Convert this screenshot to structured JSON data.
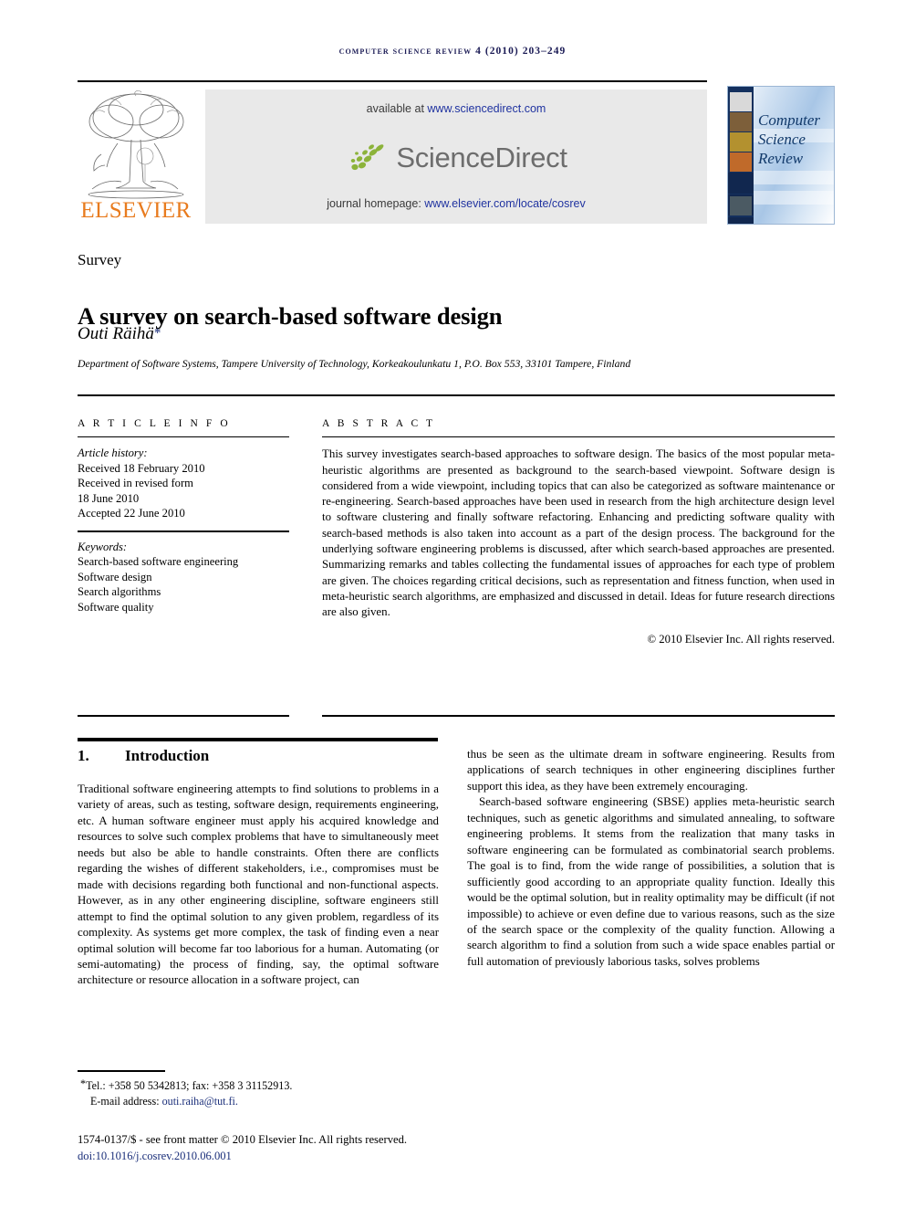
{
  "running_head": {
    "journal": "COMPUTER SCIENCE REVIEW",
    "volume_year_pages": "4 (2010) 203–249",
    "color": "#1b1b55"
  },
  "masthead": {
    "publisher_name": "ELSEVIER",
    "publisher_color": "#E87B1E",
    "available_at_label": "available at",
    "available_at_url": "www.sciencedirect.com",
    "sciencedirect_wordmark": "ScienceDirect",
    "homepage_label": "journal homepage:",
    "homepage_url": "www.elsevier.com/locate/cosrev",
    "link_color": "#2033a0",
    "band_background": "#e9e9e9"
  },
  "cover": {
    "line1": "Computer",
    "line2": "Science",
    "line3": "Review",
    "title_color": "#123a6b",
    "rail_color": "#14305e"
  },
  "article": {
    "section_label": "Survey",
    "title": "A survey on search-based software design",
    "author": "Outi Räihä",
    "author_marker": "*",
    "affiliation": "Department of Software Systems, Tampere University of Technology, Korkeakoulunkatu 1, P.O. Box 553, 33101 Tampere, Finland"
  },
  "article_info": {
    "caption": "A R T I C L E   I N F O",
    "history_label": "Article history:",
    "history": [
      "Received 18 February 2010",
      "Received in revised form",
      "18 June 2010",
      "Accepted 22 June 2010"
    ],
    "keywords_label": "Keywords:",
    "keywords": [
      "Search-based software engineering",
      "Software design",
      "Search algorithms",
      "Software quality"
    ]
  },
  "abstract": {
    "caption": "A B S T R A C T",
    "text": "This survey investigates search-based approaches to software design. The basics of the most popular meta-heuristic algorithms are presented as background to the search-based viewpoint. Software design is considered from a wide viewpoint, including topics that can also be categorized as software maintenance or re-engineering. Search-based approaches have been used in research from the high architecture design level to software clustering and finally software refactoring. Enhancing and predicting software quality with search-based methods is also taken into account as a part of the design process. The background for the underlying software engineering problems is discussed, after which search-based approaches are presented. Summarizing remarks and tables collecting the fundamental issues of approaches for each type of problem are given. The choices regarding critical decisions, such as representation and fitness function, when used in meta-heuristic search algorithms, are emphasized and discussed in detail. Ideas for future research directions are also given.",
    "copyright": "© 2010 Elsevier Inc. All rights reserved."
  },
  "introduction": {
    "number": "1.",
    "heading": "Introduction",
    "left_paragraph": "Traditional software engineering attempts to find solutions to problems in a variety of areas, such as testing, software design, requirements engineering, etc. A human software engineer must apply his acquired knowledge and resources to solve such complex problems that have to simultaneously meet needs but also be able to handle constraints. Often there are conflicts regarding the wishes of different stakeholders, i.e., compromises must be made with decisions regarding both functional and non-functional aspects. However, as in any other engineering discipline, software engineers still attempt to find the optimal solution to any given problem, regardless of its complexity. As systems get more complex, the task of finding even a near optimal solution will become far too laborious for a human. Automating (or semi-automating) the process of finding, say, the optimal software architecture or resource allocation in a software project, can",
    "right_paragraph_1": "thus be seen as the ultimate dream in software engineering. Results from applications of search techniques in other engineering disciplines further support this idea, as they have been extremely encouraging.",
    "right_paragraph_2": "Search-based software engineering (SBSE) applies meta-heuristic search techniques, such as genetic algorithms and simulated annealing, to software engineering problems. It stems from the realization that many tasks in software engineering can be formulated as combinatorial search problems. The goal is to find, from the wide range of possibilities, a solution that is sufficiently good according to an appropriate quality function. Ideally this would be the optimal solution, but in reality optimality may be difficult (if not impossible) to achieve or even define due to various reasons, such as the size of the search space or the complexity of the quality function. Allowing a search algorithm to find a solution from such a wide space enables partial or full automation of previously laborious tasks, solves problems"
  },
  "footer": {
    "footnote_marker": "*",
    "footnote_contact": "Tel.: +358 50 5342813; fax: +358 3 31152913.",
    "email_label": "E-mail address:",
    "email": "outi.raiha@tut.fi.",
    "front_matter": "1574-0137/$ - see front matter © 2010 Elsevier Inc. All rights reserved.",
    "doi": "doi:10.1016/j.cosrev.2010.06.001",
    "link_color": "#1b2f7a"
  }
}
